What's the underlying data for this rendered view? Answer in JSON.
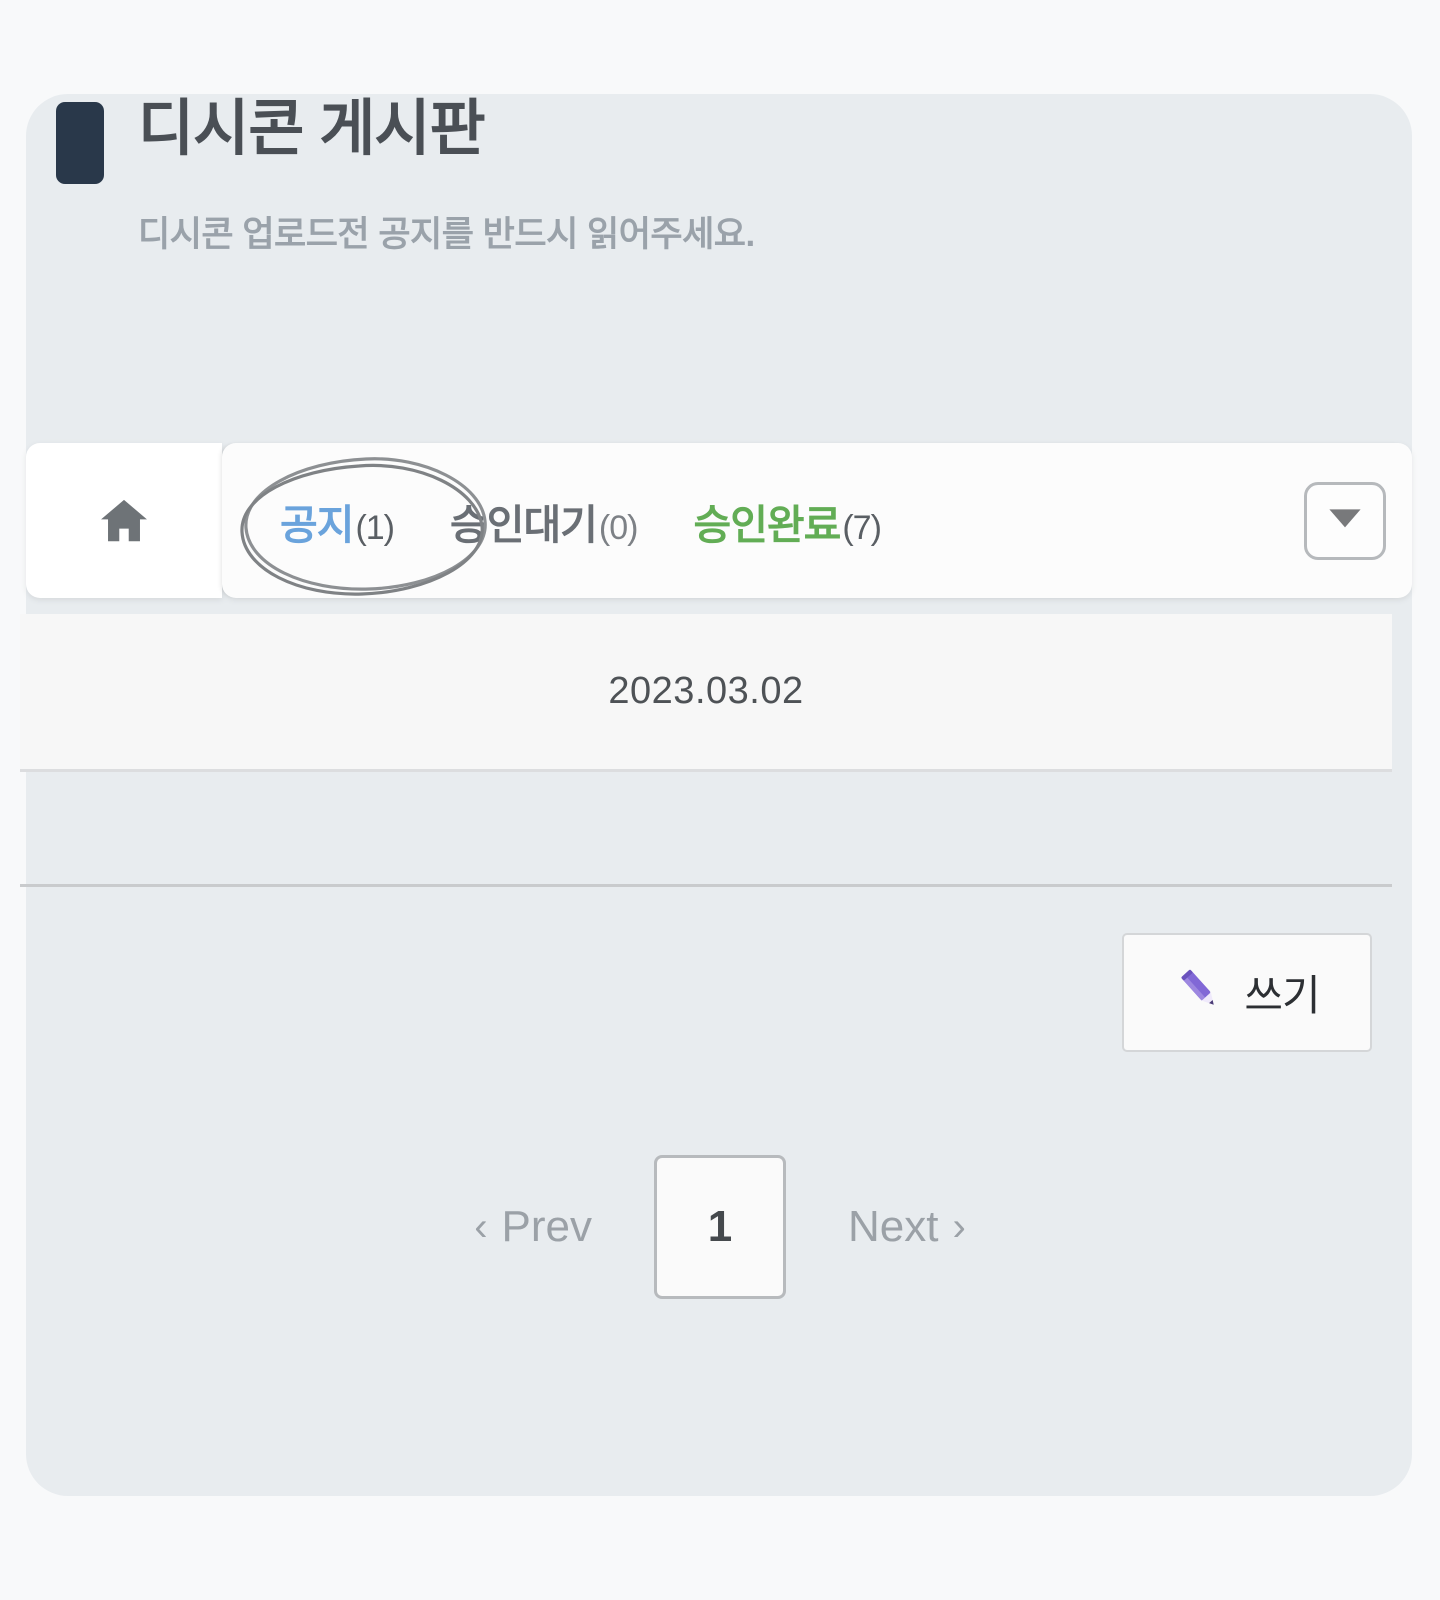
{
  "page": {
    "background_color": "#f8f9fa",
    "card_color": "#e8ecef"
  },
  "header": {
    "title": "디시콘 게시판",
    "subtitle": "디시콘 업로드전 공지를 반드시 읽어주세요.",
    "badge_color": "#29384a"
  },
  "tabbar": {
    "home_icon": "home-icon",
    "dropdown_icon": "chevron-down-icon",
    "tabs": [
      {
        "label": "공지",
        "count": "(1)",
        "color": "#6aa3dc",
        "state": "active",
        "name": "notice"
      },
      {
        "label": "승인대기",
        "count": "(0)",
        "color": "#6a6f75",
        "state": "inactive",
        "name": "pending"
      },
      {
        "label": "승인완료",
        "count": "(7)",
        "color": "#62ad55",
        "state": "inactive",
        "name": "approved"
      }
    ]
  },
  "annotation": {
    "type": "hand-drawn-ellipse",
    "target": "공지(1)",
    "color": "#8d9093"
  },
  "list": {
    "rows": [
      {
        "date": "2023.03.02"
      }
    ]
  },
  "actions": {
    "write_label": "쓰기",
    "write_icon": "pencil-icon",
    "pencil_color": "#8168d6"
  },
  "pagination": {
    "prev_label": "Prev",
    "next_label": "Next",
    "prev_chevron": "‹",
    "next_chevron": "›",
    "current_page": "1"
  }
}
